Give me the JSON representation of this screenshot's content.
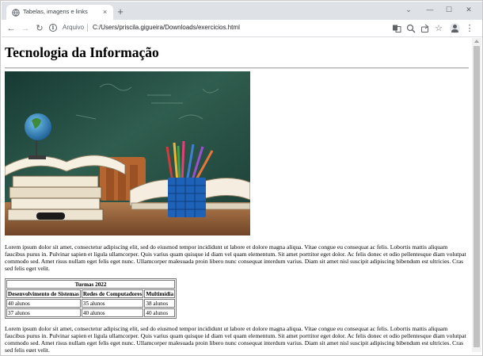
{
  "browser": {
    "tab_title": "Tabelas, imagens e links",
    "tab_close_glyph": "×",
    "new_tab_glyph": "+",
    "window_controls": {
      "dropdown": "⌄",
      "minimize": "—",
      "maximize": "☐",
      "close": "✕"
    },
    "nav": {
      "back": "←",
      "forward": "→",
      "reload": "↻"
    },
    "address": {
      "scheme_label": "Arquivo",
      "url": "C:/Users/priscila.gigueira/Downloads/exercicios.html"
    },
    "toolbar_icons": [
      "translate-icon",
      "zoom-icon",
      "share-icon",
      "bookmark-star-icon",
      "profile-icon",
      "menu-icon"
    ],
    "menu_glyph": "⋮",
    "star_glyph": "☆"
  },
  "page": {
    "heading": "Tecnologia da Informação",
    "image": "classroom-books-pencils-image",
    "paragraph1": "Lorem ipsum dolor sit amet, consectetur adipiscing elit, sed do eiusmod tempor incididunt ut labore et dolore magna aliqua. Vitae congue eu consequat ac felis. Lobortis mattis aliquam faucibus purus in. Pulvinar sapien et ligula ullamcorper. Quis varius quam quisque id diam vel quam elementum. Sit amet porttitor eget dolor. Ac felis donec et odio pellentesque diam volutpat commodo sed. Amet risus nullam eget felis eget nunc. Ullamcorper malesuada proin libero nunc consequat interdum varius. Diam sit amet nisl suscipit adipiscing bibendum est ultricies. Cras sed felis eget velit.",
    "table": {
      "caption": "Turmas 2022",
      "headers": [
        "Desenvolvimento de Sistemas",
        "Redes de Computadores",
        "Multimídia"
      ],
      "rows": [
        [
          "40 alunos",
          "35 alunos",
          "38 alunos"
        ],
        [
          "37 alunos",
          "40 alunos",
          "40 alunos"
        ]
      ]
    },
    "paragraph2": "Lorem ipsum dolor sit amet, consectetur adipiscing elit, sed do eiusmod tempor incididunt ut labore et dolore magna aliqua. Vitae congue eu consequat ac felis. Lobortis mattis aliquam faucibus purus in. Pulvinar sapien et ligula ullamcorper. Quis varius quam quisque id diam vel quam elementum. Sit amet porttitor eget dolor. Ac felis donec et odio pellentesque diam volutpat commodo sed. Amet risus nullam eget felis eget nunc. Ullamcorper malesuada proin libero nunc consequat interdum varius. Diam sit amet nisl suscipit adipiscing bibendum est ultricies. Cras sed felis eget velit."
  },
  "colors": {
    "tabstrip": "#dee1e6",
    "chalkboard": "#2f5d4e",
    "desk": "#8a5a36"
  }
}
